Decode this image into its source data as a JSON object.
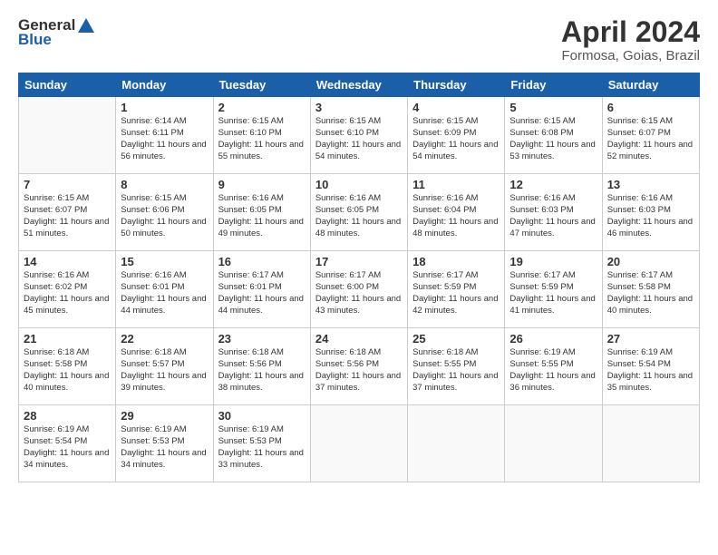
{
  "header": {
    "logo_general": "General",
    "logo_blue": "Blue",
    "month_title": "April 2024",
    "location": "Formosa, Goias, Brazil"
  },
  "weekdays": [
    "Sunday",
    "Monday",
    "Tuesday",
    "Wednesday",
    "Thursday",
    "Friday",
    "Saturday"
  ],
  "weeks": [
    [
      {
        "day": "",
        "info": ""
      },
      {
        "day": "1",
        "info": "Sunrise: 6:14 AM\nSunset: 6:11 PM\nDaylight: 11 hours\nand 56 minutes."
      },
      {
        "day": "2",
        "info": "Sunrise: 6:15 AM\nSunset: 6:10 PM\nDaylight: 11 hours\nand 55 minutes."
      },
      {
        "day": "3",
        "info": "Sunrise: 6:15 AM\nSunset: 6:10 PM\nDaylight: 11 hours\nand 54 minutes."
      },
      {
        "day": "4",
        "info": "Sunrise: 6:15 AM\nSunset: 6:09 PM\nDaylight: 11 hours\nand 54 minutes."
      },
      {
        "day": "5",
        "info": "Sunrise: 6:15 AM\nSunset: 6:08 PM\nDaylight: 11 hours\nand 53 minutes."
      },
      {
        "day": "6",
        "info": "Sunrise: 6:15 AM\nSunset: 6:07 PM\nDaylight: 11 hours\nand 52 minutes."
      }
    ],
    [
      {
        "day": "7",
        "info": "Sunrise: 6:15 AM\nSunset: 6:07 PM\nDaylight: 11 hours\nand 51 minutes."
      },
      {
        "day": "8",
        "info": "Sunrise: 6:15 AM\nSunset: 6:06 PM\nDaylight: 11 hours\nand 50 minutes."
      },
      {
        "day": "9",
        "info": "Sunrise: 6:16 AM\nSunset: 6:05 PM\nDaylight: 11 hours\nand 49 minutes."
      },
      {
        "day": "10",
        "info": "Sunrise: 6:16 AM\nSunset: 6:05 PM\nDaylight: 11 hours\nand 48 minutes."
      },
      {
        "day": "11",
        "info": "Sunrise: 6:16 AM\nSunset: 6:04 PM\nDaylight: 11 hours\nand 48 minutes."
      },
      {
        "day": "12",
        "info": "Sunrise: 6:16 AM\nSunset: 6:03 PM\nDaylight: 11 hours\nand 47 minutes."
      },
      {
        "day": "13",
        "info": "Sunrise: 6:16 AM\nSunset: 6:03 PM\nDaylight: 11 hours\nand 46 minutes."
      }
    ],
    [
      {
        "day": "14",
        "info": "Sunrise: 6:16 AM\nSunset: 6:02 PM\nDaylight: 11 hours\nand 45 minutes."
      },
      {
        "day": "15",
        "info": "Sunrise: 6:16 AM\nSunset: 6:01 PM\nDaylight: 11 hours\nand 44 minutes."
      },
      {
        "day": "16",
        "info": "Sunrise: 6:17 AM\nSunset: 6:01 PM\nDaylight: 11 hours\nand 44 minutes."
      },
      {
        "day": "17",
        "info": "Sunrise: 6:17 AM\nSunset: 6:00 PM\nDaylight: 11 hours\nand 43 minutes."
      },
      {
        "day": "18",
        "info": "Sunrise: 6:17 AM\nSunset: 5:59 PM\nDaylight: 11 hours\nand 42 minutes."
      },
      {
        "day": "19",
        "info": "Sunrise: 6:17 AM\nSunset: 5:59 PM\nDaylight: 11 hours\nand 41 minutes."
      },
      {
        "day": "20",
        "info": "Sunrise: 6:17 AM\nSunset: 5:58 PM\nDaylight: 11 hours\nand 40 minutes."
      }
    ],
    [
      {
        "day": "21",
        "info": "Sunrise: 6:18 AM\nSunset: 5:58 PM\nDaylight: 11 hours\nand 40 minutes."
      },
      {
        "day": "22",
        "info": "Sunrise: 6:18 AM\nSunset: 5:57 PM\nDaylight: 11 hours\nand 39 minutes."
      },
      {
        "day": "23",
        "info": "Sunrise: 6:18 AM\nSunset: 5:56 PM\nDaylight: 11 hours\nand 38 minutes."
      },
      {
        "day": "24",
        "info": "Sunrise: 6:18 AM\nSunset: 5:56 PM\nDaylight: 11 hours\nand 37 minutes."
      },
      {
        "day": "25",
        "info": "Sunrise: 6:18 AM\nSunset: 5:55 PM\nDaylight: 11 hours\nand 37 minutes."
      },
      {
        "day": "26",
        "info": "Sunrise: 6:19 AM\nSunset: 5:55 PM\nDaylight: 11 hours\nand 36 minutes."
      },
      {
        "day": "27",
        "info": "Sunrise: 6:19 AM\nSunset: 5:54 PM\nDaylight: 11 hours\nand 35 minutes."
      }
    ],
    [
      {
        "day": "28",
        "info": "Sunrise: 6:19 AM\nSunset: 5:54 PM\nDaylight: 11 hours\nand 34 minutes."
      },
      {
        "day": "29",
        "info": "Sunrise: 6:19 AM\nSunset: 5:53 PM\nDaylight: 11 hours\nand 34 minutes."
      },
      {
        "day": "30",
        "info": "Sunrise: 6:19 AM\nSunset: 5:53 PM\nDaylight: 11 hours\nand 33 minutes."
      },
      {
        "day": "",
        "info": ""
      },
      {
        "day": "",
        "info": ""
      },
      {
        "day": "",
        "info": ""
      },
      {
        "day": "",
        "info": ""
      }
    ]
  ]
}
